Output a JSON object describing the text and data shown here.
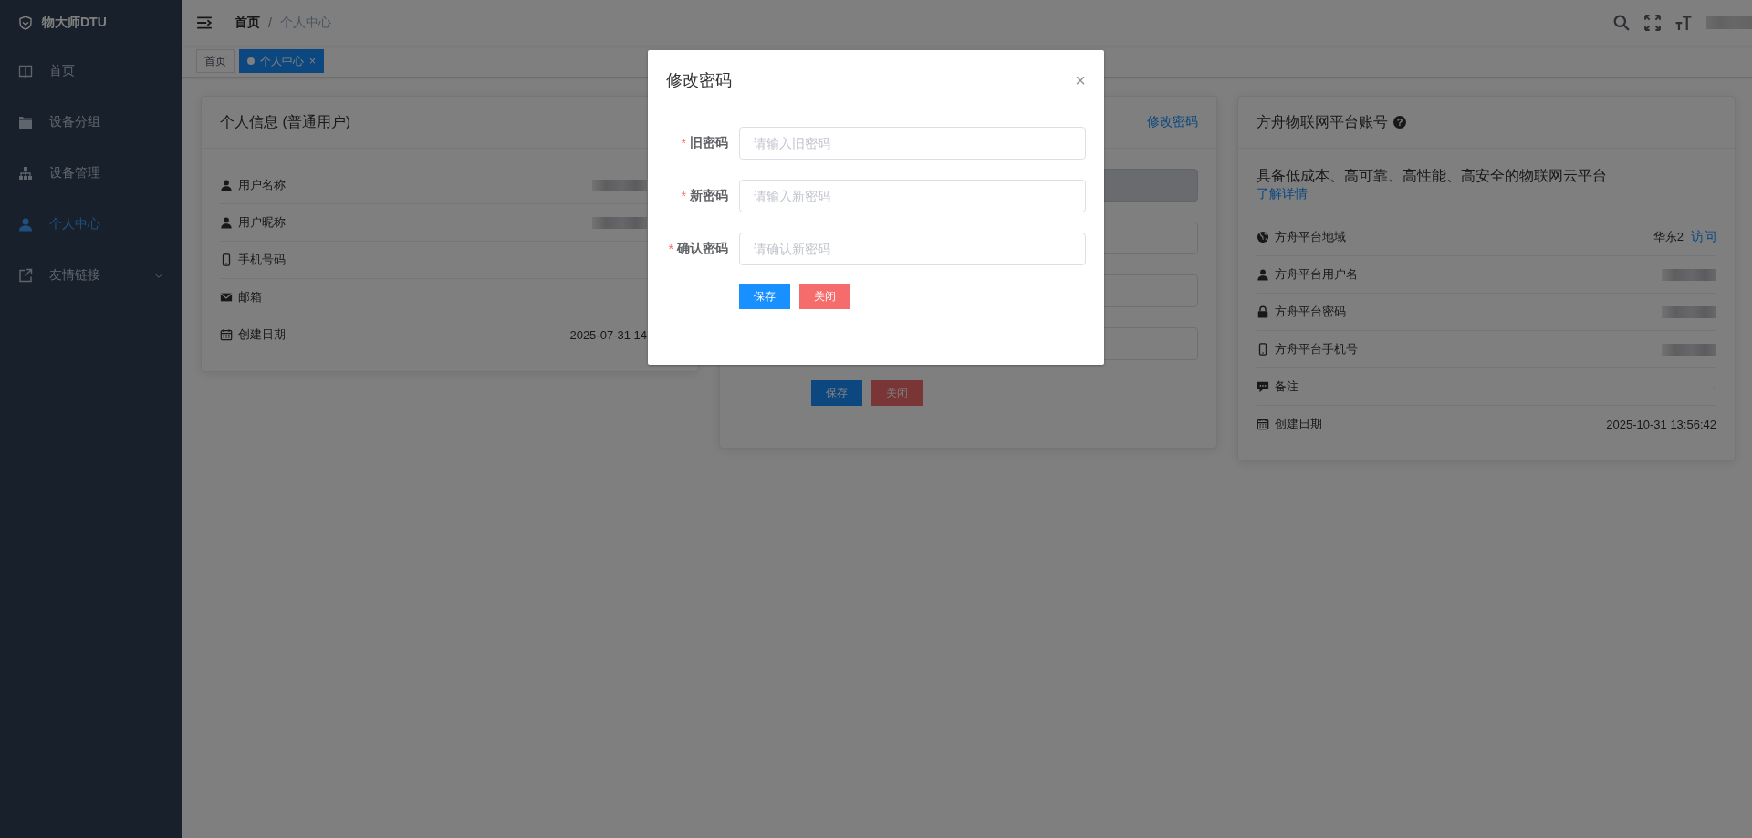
{
  "sidebar": {
    "logo": "物大师DTU",
    "items": [
      {
        "label": "首页",
        "selected": false,
        "expandable": false
      },
      {
        "label": "设备分组",
        "selected": false,
        "expandable": false
      },
      {
        "label": "设备管理",
        "selected": false,
        "expandable": false
      },
      {
        "label": "个人中心",
        "selected": true,
        "expandable": false
      },
      {
        "label": "友情链接",
        "selected": false,
        "expandable": true
      }
    ]
  },
  "header": {
    "breadcrumb": [
      "首页",
      "个人中心"
    ],
    "separator": "/"
  },
  "tags": [
    {
      "label": "首页",
      "selected": false,
      "closable": false
    },
    {
      "label": "个人中心",
      "selected": true,
      "closable": true,
      "close": "×"
    }
  ],
  "profile_card": {
    "title": "个人信息 (普通用户)",
    "rows": [
      {
        "label": "用户名称",
        "blurred": true
      },
      {
        "label": "用户昵称",
        "blurred": true
      },
      {
        "label": "手机号码",
        "blurred": false
      },
      {
        "label": "邮箱",
        "blurred": false
      },
      {
        "label": "创建日期",
        "blurred": false,
        "value": "2025-07-31 14"
      }
    ]
  },
  "password_card": {
    "link": "修改密码",
    "fields": [
      {
        "kind": "readonly"
      },
      {
        "kind": "input"
      },
      {
        "kind": "input"
      },
      {
        "kind": "input"
      }
    ],
    "buttons": [
      {
        "label": "保存",
        "kind": "primary"
      },
      {
        "label": "关闭",
        "kind": "danger"
      }
    ]
  },
  "platform_card": {
    "title": "方舟物联网平台账号",
    "help": "?",
    "description": "具备低成本、高可靠、高性能、高安全的物联网云平台",
    "more_link": "了解详情",
    "rows": [
      {
        "label": "方舟平台地域",
        "value": "华东2",
        "link": "访问",
        "blurred": false
      },
      {
        "label": "方舟平台用户名",
        "blurred": true
      },
      {
        "label": "方舟平台密码",
        "blurred": true
      },
      {
        "label": "方舟平台手机号",
        "blurred": true
      },
      {
        "label": "备注",
        "value": "-",
        "blurred": false
      },
      {
        "label": "创建日期",
        "value": "2025-10-31 13:56:42",
        "blurred": false
      }
    ]
  },
  "dialog": {
    "title": "修改密码",
    "close": "×",
    "fields": [
      {
        "label": "旧密码",
        "required": true,
        "placeholder": "请输入旧密码"
      },
      {
        "label": "新密码",
        "required": true,
        "placeholder": "请输入新密码"
      },
      {
        "label": "确认密码",
        "required": true,
        "placeholder": "请确认新密码"
      }
    ],
    "required_mark": "*",
    "buttons": [
      {
        "label": "保存",
        "kind": "primary"
      },
      {
        "label": "关闭",
        "kind": "danger"
      }
    ]
  }
}
